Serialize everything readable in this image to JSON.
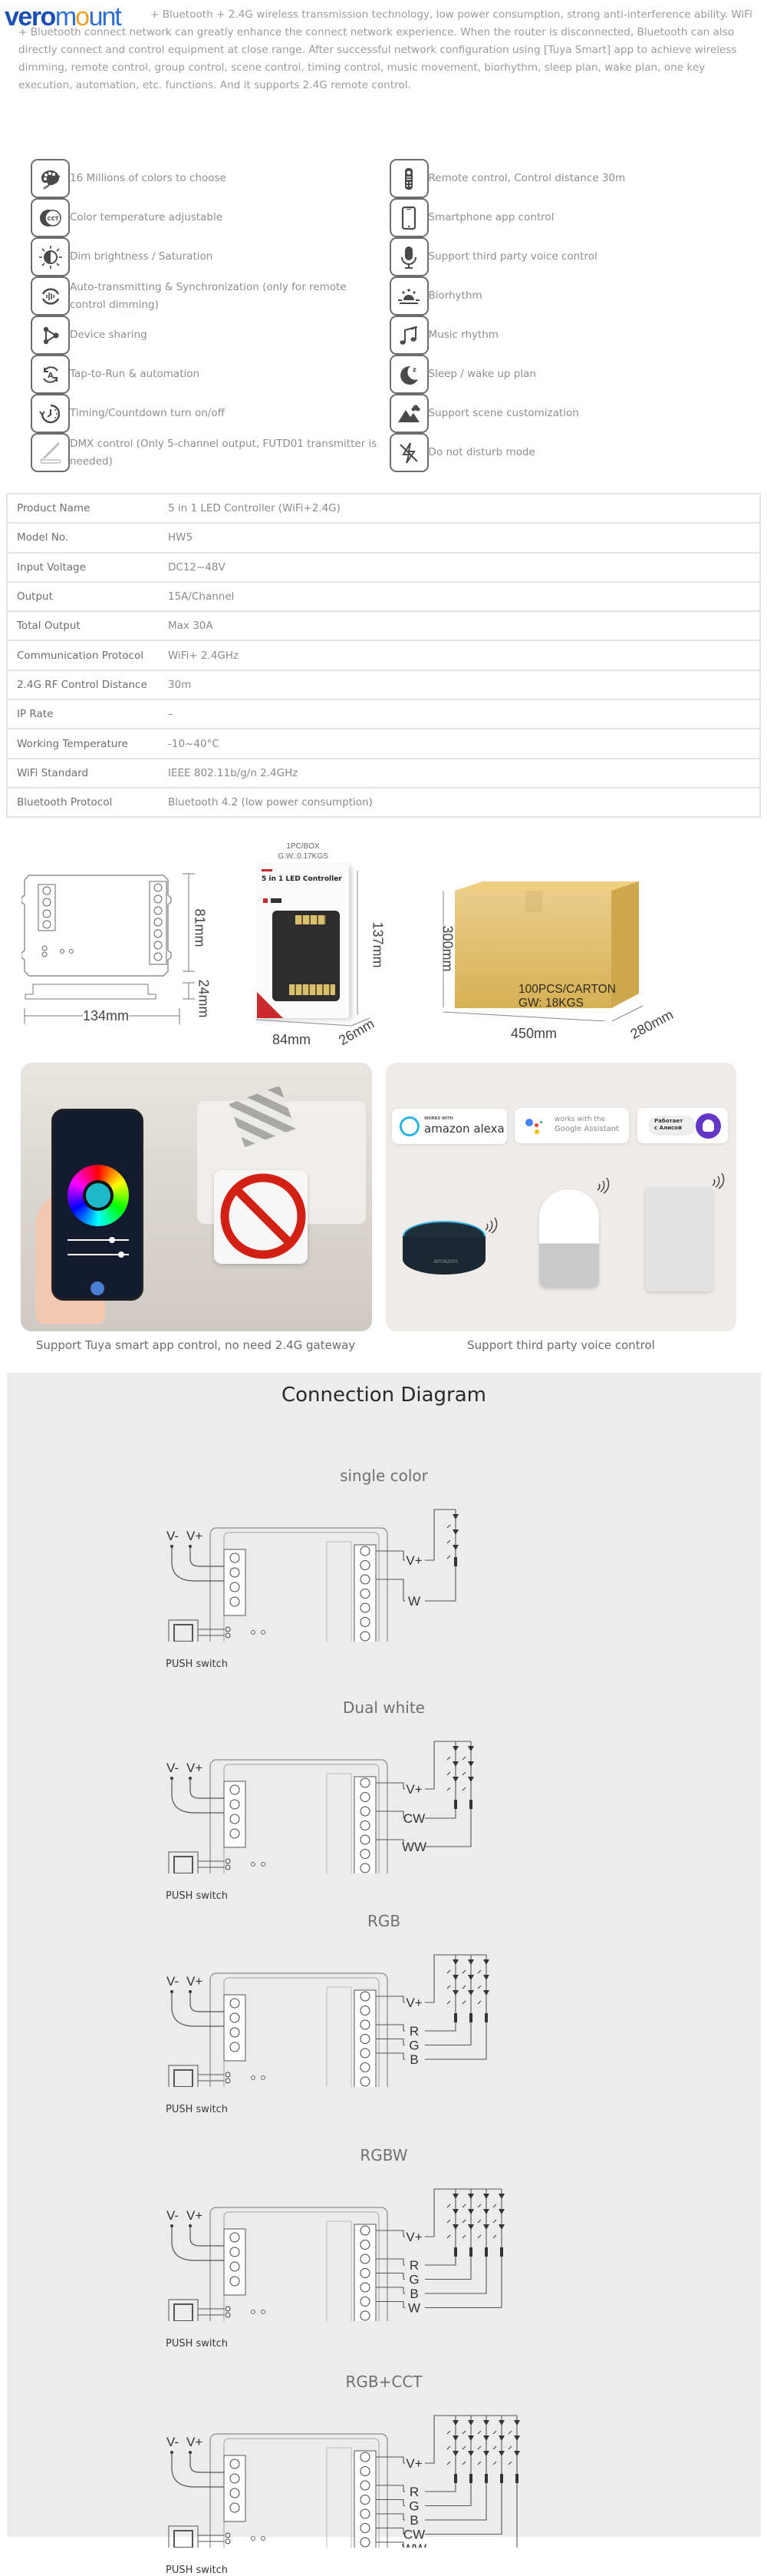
{
  "brand": {
    "logo_part1": "vero",
    "logo_part2_pre": "m",
    "logo_part2_o": "o",
    "logo_part2_post": "unt"
  },
  "intro": {
    "text": "+ Bluetooth + 2.4G wireless transmission technology, low power consumption, strong anti-interference ability. WiFi + Bluetooth connect network can greatly enhance the connect network experience. When the router is disconnected, Bluetooth can also directly connect and control equipment at close range. After successful network configuration using [Tuya Smart] app to achieve wireless dimming, remote control, group control, scene control, timing control, music movement, biorhythm, sleep plan, wake plan, one key execution, automation, etc. functions. And it supports 2.4G remote control."
  },
  "features": {
    "left": [
      {
        "icon": "palette-icon",
        "label": "16 Millions of colors to choose"
      },
      {
        "icon": "cct-icon",
        "label": "Color temperature adjustable"
      },
      {
        "icon": "brightness-icon",
        "label": "Dim brightness / Saturation"
      },
      {
        "icon": "sync-icon",
        "label": "Auto-transmitting & Synchronization (only for remote control dimming)"
      },
      {
        "icon": "share-icon",
        "label": "Device sharing"
      },
      {
        "icon": "automation-icon",
        "label": "Tap-to-Run & automation"
      },
      {
        "icon": "timer-icon",
        "label": "Timing/Countdown turn on/off"
      },
      {
        "icon": "dmx-icon",
        "label": "DMX control (Only 5-channel output, FUTD01 transmitter is needed)"
      }
    ],
    "right": [
      {
        "icon": "remote-icon",
        "label": "Remote control, Control distance 30m"
      },
      {
        "icon": "smartphone-icon",
        "label": "Smartphone app control"
      },
      {
        "icon": "microphone-icon",
        "label": "Support third party voice control"
      },
      {
        "icon": "sunrise-icon",
        "label": "Biorhythm"
      },
      {
        "icon": "music-icon",
        "label": "Music rhythm"
      },
      {
        "icon": "moon-icon",
        "label": "Sleep / wake up plan"
      },
      {
        "icon": "scene-icon",
        "label": "Support scene customization"
      },
      {
        "icon": "do-not-disturb-icon",
        "label": "Do not disturb mode"
      }
    ]
  },
  "specs": [
    {
      "key": "Product Name",
      "value": "5 in 1 LED Controller (WiFi+2.4G)"
    },
    {
      "key": "Model No.",
      "value": "HW5"
    },
    {
      "key": "Input Voltage",
      "value": "DC12~48V"
    },
    {
      "key": "Output",
      "value": "15A/Channel"
    },
    {
      "key": "Total Output",
      "value": "Max 30A"
    },
    {
      "key": "Communication Protocol",
      "value": "WiFi+ 2.4GHz"
    },
    {
      "key": "2.4G RF Control Distance",
      "value": " 30m"
    },
    {
      "key": "IP Rate",
      "value": "–"
    },
    {
      "key": "Working Temperature",
      "value": "-10~40°C"
    },
    {
      "key": "WiFi Standard",
      "value": "IEEE 802.11b/g/n 2.4GHz"
    },
    {
      "key": "Bluetooth Protocol",
      "value": "Bluetooth 4.2 (low power consumption)"
    }
  ],
  "dimensions": {
    "controller_height": "81mm",
    "controller_depth": "24mm",
    "controller_width": "134mm",
    "box_pack_line1": "1PC/BOX",
    "box_pack_line2": "G.W.:0.17KGS",
    "box_product_title": "5 in 1 LED Controller",
    "box_height": "137mm",
    "box_width": "84mm",
    "box_depth": "26mm",
    "carton_height": "300mm",
    "carton_width": "450mm",
    "carton_depth": "280mm",
    "carton_line1": "100PCS/CARTON",
    "carton_line2": "GW: 18KGS"
  },
  "cards": {
    "app_caption": "Support Tuya smart app control, no need 2.4G gateway",
    "voice_caption": "Support third party voice control",
    "badges": [
      {
        "small": "WORKS WITH",
        "big": "amazon alexa"
      },
      {
        "small": "works with the",
        "big": "Google Assistant"
      },
      {
        "small": "Работает",
        "big": "с Алисой"
      }
    ],
    "speaker_brand": "amazon"
  },
  "connection": {
    "title": "Connection Diagram",
    "push_label": "PUSH switch",
    "input_minus": "V-",
    "input_plus": "V+",
    "diagrams": [
      {
        "title": "single color",
        "outputs": [
          "V+",
          "W"
        ],
        "strings": 1
      },
      {
        "title": "Dual white",
        "outputs": [
          "V+",
          "CW",
          "WW"
        ],
        "strings": 2
      },
      {
        "title": "RGB",
        "outputs": [
          "V+",
          "R",
          "G",
          "B"
        ],
        "strings": 3
      },
      {
        "title": "RGBW",
        "outputs": [
          "V+",
          "R",
          "G",
          "B",
          "W"
        ],
        "strings": 4
      },
      {
        "title": "RGB+CCT",
        "outputs": [
          "V+",
          "R",
          "G",
          "B",
          "CW",
          "WW"
        ],
        "strings": 5
      }
    ]
  }
}
